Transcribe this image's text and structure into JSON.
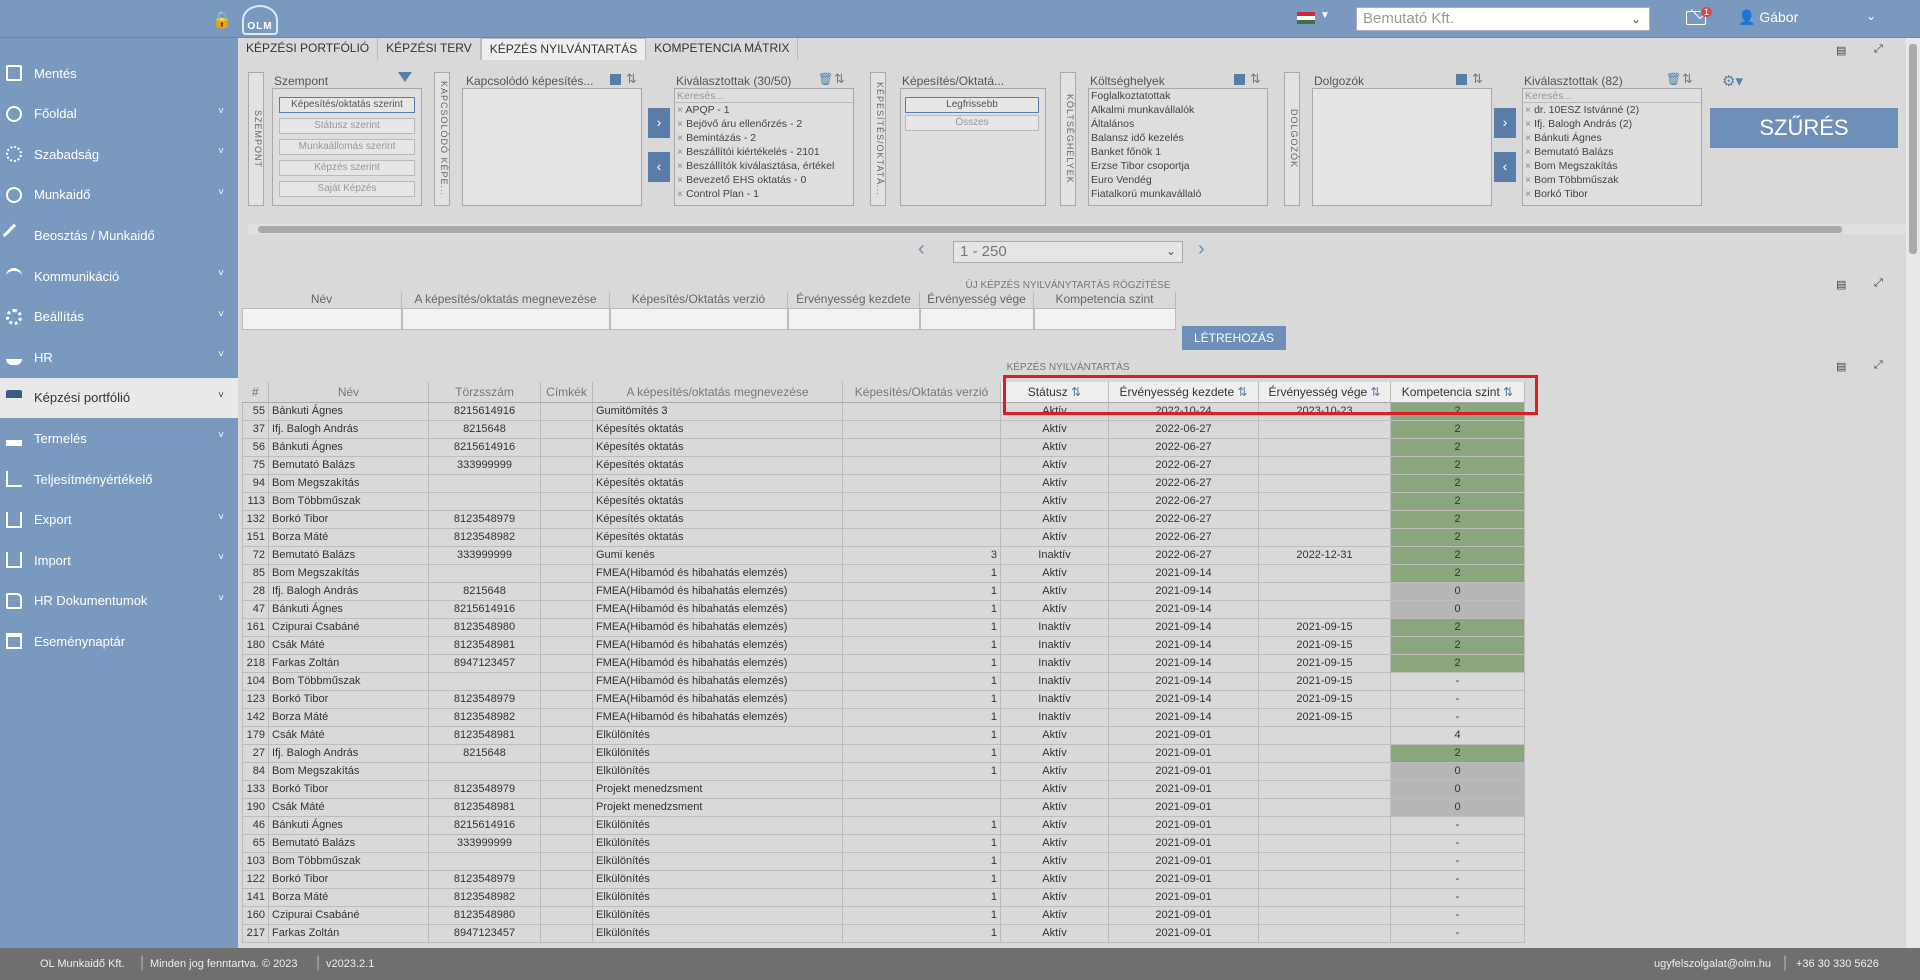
{
  "header": {
    "company": "Bemutató Kft.",
    "user": "Gábor",
    "logo_text": "OLM",
    "mail_badge": "1"
  },
  "sidebar": {
    "items": [
      {
        "label": "Mentés",
        "icon": "save-icon"
      },
      {
        "label": "Főoldal",
        "icon": "globe-icon",
        "chevron": true
      },
      {
        "label": "Szabadság",
        "icon": "sun-icon",
        "chevron": true
      },
      {
        "label": "Munkaidő",
        "icon": "clock-icon",
        "chevron": true
      },
      {
        "label": "Beosztás / Munkaidő",
        "icon": "tools-icon"
      },
      {
        "label": "Kommunikáció",
        "icon": "broadcast-icon",
        "chevron": true
      },
      {
        "label": "Beállítás",
        "icon": "gear-icon",
        "chevron": true
      },
      {
        "label": "HR",
        "icon": "people-icon",
        "chevron": true
      },
      {
        "label": "Képzési portfólió",
        "icon": "graduation-icon",
        "chevron": true,
        "active": true
      },
      {
        "label": "Termelés",
        "icon": "factory-icon",
        "chevron": true
      },
      {
        "label": "Teljesítményértékelő",
        "icon": "chart-icon"
      },
      {
        "label": "Export",
        "icon": "export-icon",
        "chevron": true
      },
      {
        "label": "Import",
        "icon": "import-icon",
        "chevron": true
      },
      {
        "label": "HR Dokumentumok",
        "icon": "folder-icon",
        "chevron": true
      },
      {
        "label": "Eseménynaptár",
        "icon": "calendar-icon"
      }
    ]
  },
  "tabs": [
    "KÉPZÉSI PORTFÓLIÓ",
    "KÉPZÉSI TERV",
    "KÉPZÉS NYILVÁNTARTÁS",
    "KOMPETENCIA MÁTRIX"
  ],
  "filters": {
    "szempont_label": "SZEMPONT",
    "szempont_title": "Szempont",
    "szempont_options": [
      "Képesítés/oktatás szerint",
      "Státusz szerint",
      "Munkaállomás szerint",
      "Képzés szerint",
      "Saját Képzés"
    ],
    "kapcsolodo_label": "KAPCSOLÓDÓ KÉPE...",
    "kapcsolodo_title": "Kapcsolódó képesítés...",
    "kivalasztottak1_title": "Kiválasztottak (30/50)",
    "search_placeholder": "Keresés...",
    "kivalasztottak1_items": [
      "APQP - 1",
      "Bejövő áru ellenőrzés - 2",
      "Bemintázás - 2",
      "Beszállítói kiértékelés - 2101",
      "Beszállítók kiválasztása, értékel",
      "Bevezető EHS oktatás - 0",
      "Control Plan - 1"
    ],
    "kepesites_label": "KÉPESÍTÉS/OKTATÁ...",
    "kepesites_title": "Képesítés/Oktatá...",
    "kepesites_options": [
      "Legfrissebb",
      "Összes"
    ],
    "koltseghely_label": "KÖLTSÉGHELYEK",
    "koltseghely_title": "Költséghelyek",
    "koltseghely_items": [
      "Foglalkoztatottak",
      "Alkalmi munkavállalók",
      "Általános",
      "Balansz idő kezelés",
      "Banket főnök 1",
      "Erzse Tibor csoportja",
      "Euro Vendég",
      "Fiatalkorú munkavállaló"
    ],
    "dolgozok_label": "DOLGOZÓK",
    "dolgozok_title": "Dolgozók",
    "kivalasztottak2_title": "Kiválasztottak (82)",
    "kivalasztottak2_items": [
      "dr. 10ESZ Istvánné (2)",
      "Ifj. Balogh András (2)",
      "Bánkuti Ágnes",
      "Bemutató Balázs",
      "Bom Megszakítás",
      "Bom Többműszak",
      "Borkó Tibor"
    ],
    "filter_button": "SZŰRÉS"
  },
  "pager": {
    "range": "1 - 250"
  },
  "new_record": {
    "title": "ÚJ KÉPZÉS NYILVÁNYTARTÁS RÖGZÍTÉSE",
    "columns": [
      "Név",
      "A képesítés/oktatás megnevezése",
      "Képesítés/Oktatás verzió",
      "Érvényesség kezdete",
      "Érvényesség vége",
      "Kompetencia szint"
    ],
    "create_button": "LÉTREHOZÁS"
  },
  "registry": {
    "title": "KÉPZÉS NYILVÁNTARTÁS",
    "columns": [
      "#",
      "Név",
      "Törzsszám",
      "Címkék",
      "A képesítés/oktatás megnevezése",
      "Képesítés/Oktatás verzió",
      "Státusz",
      "Érvényesség kezdete",
      "Érvényesség vége",
      "Kompetencia szint"
    ],
    "rows": [
      [
        "55",
        "Bánkuti Ágnes",
        "8215614916",
        "",
        "Gumitömítés 3",
        "",
        "Aktív",
        "2022-10-24",
        "2023-10-23",
        "2",
        "g"
      ],
      [
        "37",
        "Ifj. Balogh András",
        "8215648",
        "",
        "Képesítés oktatás",
        "",
        "Aktív",
        "2022-06-27",
        "",
        "2",
        "g"
      ],
      [
        "56",
        "Bánkuti Ágnes",
        "8215614916",
        "",
        "Képesítés oktatás",
        "",
        "Aktív",
        "2022-06-27",
        "",
        "2",
        "g"
      ],
      [
        "75",
        "Bemutató Balázs",
        "333999999",
        "",
        "Képesítés oktatás",
        "",
        "Aktív",
        "2022-06-27",
        "",
        "2",
        "g"
      ],
      [
        "94",
        "Bom Megszakítás",
        "",
        "",
        "Képesítés oktatás",
        "",
        "Aktív",
        "2022-06-27",
        "",
        "2",
        "g"
      ],
      [
        "113",
        "Bom Többműszak",
        "",
        "",
        "Képesítés oktatás",
        "",
        "Aktív",
        "2022-06-27",
        "",
        "2",
        "g"
      ],
      [
        "132",
        "Borkó Tibor",
        "8123548979",
        "",
        "Képesítés oktatás",
        "",
        "Aktív",
        "2022-06-27",
        "",
        "2",
        "g"
      ],
      [
        "151",
        "Borza Máté",
        "8123548982",
        "",
        "Képesítés oktatás",
        "",
        "Aktív",
        "2022-06-27",
        "",
        "2",
        "g"
      ],
      [
        "72",
        "Bemutató Balázs",
        "333999999",
        "",
        "Gumi kenés",
        "3",
        "Inaktív",
        "2022-06-27",
        "2022-12-31",
        "2",
        "g"
      ],
      [
        "85",
        "Bom Megszakítás",
        "",
        "",
        "FMEA(Hibamód és hibahatás elemzés)",
        "1",
        "Aktív",
        "2021-09-14",
        "",
        "2",
        "g"
      ],
      [
        "28",
        "Ifj. Balogh András",
        "8215648",
        "",
        "FMEA(Hibamód és hibahatás elemzés)",
        "1",
        "Aktív",
        "2021-09-14",
        "",
        "0",
        "gy"
      ],
      [
        "47",
        "Bánkuti Ágnes",
        "8215614916",
        "",
        "FMEA(Hibamód és hibahatás elemzés)",
        "1",
        "Aktív",
        "2021-09-14",
        "",
        "0",
        "gy"
      ],
      [
        "161",
        "Czipurai Csabáné",
        "8123548980",
        "",
        "FMEA(Hibamód és hibahatás elemzés)",
        "1",
        "Inaktív",
        "2021-09-14",
        "2021-09-15",
        "2",
        "g"
      ],
      [
        "180",
        "Csák Máté",
        "8123548981",
        "",
        "FMEA(Hibamód és hibahatás elemzés)",
        "1",
        "Inaktív",
        "2021-09-14",
        "2021-09-15",
        "2",
        "g"
      ],
      [
        "218",
        "Farkas Zoltán",
        "8947123457",
        "",
        "FMEA(Hibamód és hibahatás elemzés)",
        "1",
        "Inaktív",
        "2021-09-14",
        "2021-09-15",
        "2",
        "g"
      ],
      [
        "104",
        "Bom Többműszak",
        "",
        "",
        "FMEA(Hibamód és hibahatás elemzés)",
        "1",
        "Inaktív",
        "2021-09-14",
        "2021-09-15",
        "-",
        ""
      ],
      [
        "123",
        "Borkó Tibor",
        "8123548979",
        "",
        "FMEA(Hibamód és hibahatás elemzés)",
        "1",
        "Inaktív",
        "2021-09-14",
        "2021-09-15",
        "-",
        ""
      ],
      [
        "142",
        "Borza Máté",
        "8123548982",
        "",
        "FMEA(Hibamód és hibahatás elemzés)",
        "1",
        "Inaktív",
        "2021-09-14",
        "2021-09-15",
        "-",
        ""
      ],
      [
        "179",
        "Csák Máté",
        "8123548981",
        "",
        "Elkülönítés",
        "1",
        "Aktív",
        "2021-09-01",
        "",
        "4",
        ""
      ],
      [
        "27",
        "Ifj. Balogh András",
        "8215648",
        "",
        "Elkülönítés",
        "1",
        "Aktív",
        "2021-09-01",
        "",
        "2",
        "g"
      ],
      [
        "84",
        "Bom Megszakítás",
        "",
        "",
        "Elkülönítés",
        "1",
        "Aktív",
        "2021-09-01",
        "",
        "0",
        "gy"
      ],
      [
        "133",
        "Borkó Tibor",
        "8123548979",
        "",
        "Projekt menedzsment",
        "",
        "Aktív",
        "2021-09-01",
        "",
        "0",
        "gy"
      ],
      [
        "190",
        "Csák Máté",
        "8123548981",
        "",
        "Projekt menedzsment",
        "",
        "Aktív",
        "2021-09-01",
        "",
        "0",
        "gy"
      ],
      [
        "46",
        "Bánkuti Ágnes",
        "8215614916",
        "",
        "Elkülönítés",
        "1",
        "Aktív",
        "2021-09-01",
        "",
        "-",
        ""
      ],
      [
        "65",
        "Bemutató Balázs",
        "333999999",
        "",
        "Elkülönítés",
        "1",
        "Aktív",
        "2021-09-01",
        "",
        "-",
        ""
      ],
      [
        "103",
        "Bom Többműszak",
        "",
        "",
        "Elkülönítés",
        "1",
        "Aktív",
        "2021-09-01",
        "",
        "-",
        ""
      ],
      [
        "122",
        "Borkó Tibor",
        "8123548979",
        "",
        "Elkülönítés",
        "1",
        "Aktív",
        "2021-09-01",
        "",
        "-",
        ""
      ],
      [
        "141",
        "Borza Máté",
        "8123548982",
        "",
        "Elkülönítés",
        "1",
        "Aktív",
        "2021-09-01",
        "",
        "-",
        ""
      ],
      [
        "160",
        "Czipurai Csabáné",
        "8123548980",
        "",
        "Elkülönítés",
        "1",
        "Aktív",
        "2021-09-01",
        "",
        "-",
        ""
      ],
      [
        "217",
        "Farkas Zoltán",
        "8947123457",
        "",
        "Elkülönítés",
        "1",
        "Aktív",
        "2021-09-01",
        "",
        "-",
        ""
      ]
    ]
  },
  "footer": {
    "company": "OL Munkaidő Kft.",
    "rights": "Minden jog fenntartva. © 2023",
    "version": "v2023.2.1",
    "email": "ugyfelszolgalat@olm.hu",
    "phone": "+36 30 330 5626"
  },
  "colors": {
    "accent": "#7a99bf",
    "level_green": "#8aa67c",
    "level_gray": "#b6b6b6",
    "highlight": "#e01b24"
  }
}
